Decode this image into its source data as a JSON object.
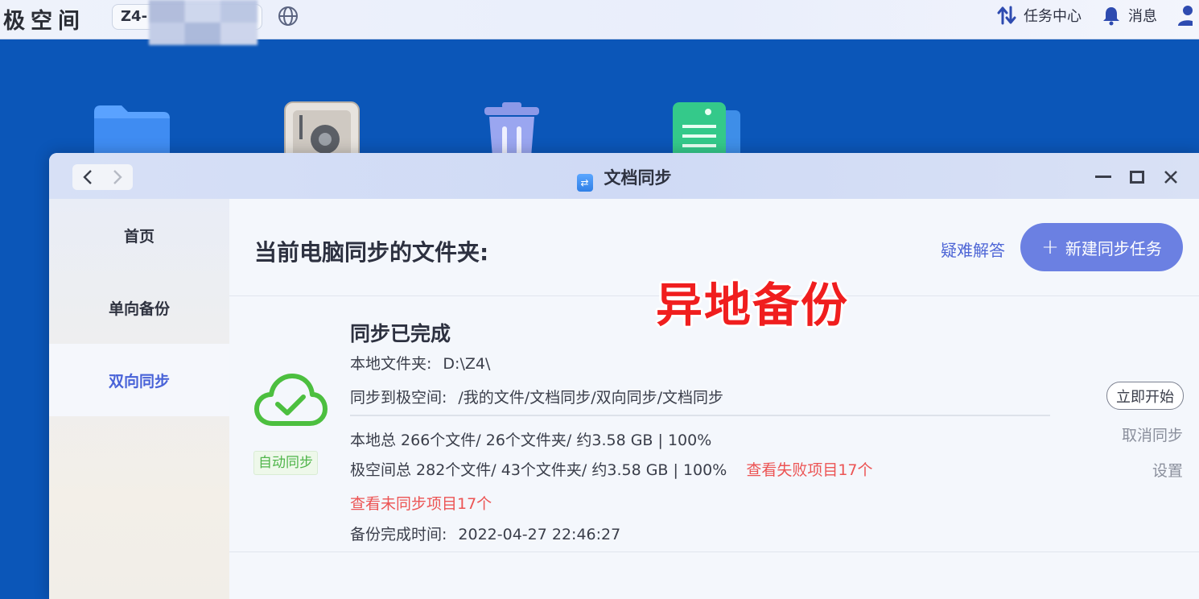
{
  "topbar": {
    "logo": "极空间",
    "device_name": "Z4-",
    "task_center": "任务中心",
    "messages": "消息"
  },
  "window": {
    "title": "文档同步"
  },
  "sidebar": {
    "items": [
      {
        "label": "首页",
        "active": false
      },
      {
        "label": "单向备份",
        "active": false
      },
      {
        "label": "双向同步",
        "active": true
      }
    ]
  },
  "main": {
    "heading": "当前电脑同步的文件夹:",
    "faq_link": "疑难解答",
    "new_task_button": "新建同步任务",
    "overlay_text": "异地备份"
  },
  "task": {
    "status": "同步已完成",
    "mode_tag": "自动同步",
    "local_folder_label": "本地文件夹:",
    "local_folder_value": "D:\\Z4\\",
    "remote_label": "同步到极空间:",
    "remote_value": "/我的文件/文档同步/双向同步/文档同步",
    "local_stats": "本地总 266个文件/ 26个文件夹/ 约3.58 GB | 100%",
    "remote_stats": "极空间总 282个文件/ 43个文件夹/ 约3.58 GB | 100%",
    "failed_link": "查看失败项目17个",
    "unsynced_link": "查看未同步项目17个",
    "completed_time_label": "备份完成时间:",
    "completed_time_value": "2022-04-27 22:46:27",
    "start_now_button": "立即开始",
    "cancel_sync": "取消同步",
    "settings": "设置"
  },
  "colors": {
    "accent": "#6b80e2",
    "link_blue": "#4e66d6",
    "success_green": "#4cbf3f",
    "danger_red": "#ec5454"
  }
}
